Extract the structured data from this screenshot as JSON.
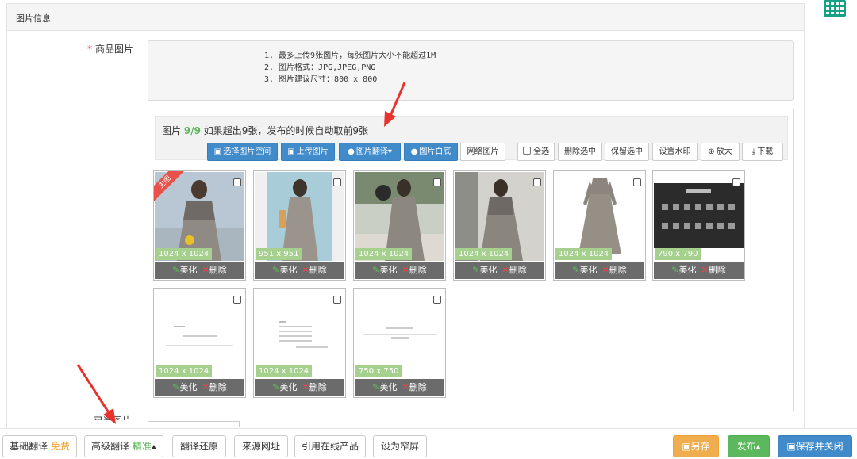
{
  "panel": {
    "title": "图片信息"
  },
  "field": {
    "required_mark": "*",
    "label": "商品图片",
    "partial_label": "已选图片"
  },
  "hint": {
    "lines": [
      "1. 最多上传9张图片，每张图片大小不能超过1M",
      "2. 图片格式：JPG,JPEG,PNG",
      "3. 图片建议尺寸：800 x 800"
    ]
  },
  "uploader": {
    "count_prefix": "图片",
    "count_value": "9/9",
    "count_suffix": "如果超出9张，发布的时候自动取前9张",
    "buttons": [
      {
        "label": "选择图片空间",
        "icon": "image-icon"
      },
      {
        "label": "上传图片",
        "icon": "image-icon"
      },
      {
        "label": "图片翻译",
        "icon": "info-icon",
        "caret": "▾"
      },
      {
        "label": "图片白底",
        "icon": "info-icon"
      },
      {
        "label": "网络图片"
      }
    ],
    "select_all": "全选",
    "actions": [
      "删除选中",
      "保留选中",
      "设置水印",
      "放大",
      "下载"
    ]
  },
  "images": [
    {
      "size": "1024 x 1024",
      "main": "主图"
    },
    {
      "size": "951 x 951"
    },
    {
      "size": "1024 x 1024"
    },
    {
      "size": "1024 x 1024"
    },
    {
      "size": "1024 x 1024"
    },
    {
      "size": "790 x 790"
    },
    {
      "size": "1024 x 1024"
    },
    {
      "size": "1024 x 1024"
    },
    {
      "size": "750 x 750"
    }
  ],
  "image_actions": {
    "beautify": "美化",
    "delete": "删除"
  },
  "footer": {
    "basic_translate": "基础翻译",
    "free": "免费",
    "advanced_translate": "高级翻译",
    "fine": "精准",
    "restore": "翻译还原",
    "source_url": "来源网址",
    "quote_product": "引用在线产品",
    "narrow_screen": "设为窄屏",
    "save_as": "另存",
    "publish": "发布",
    "save_close": "保存并关闭"
  },
  "colors": {
    "primary": "#428bca",
    "save_as": "#f0ad4e",
    "publish": "#5cb85c",
    "arrow": "#e8322b",
    "size_tag": "#a6d08e"
  }
}
